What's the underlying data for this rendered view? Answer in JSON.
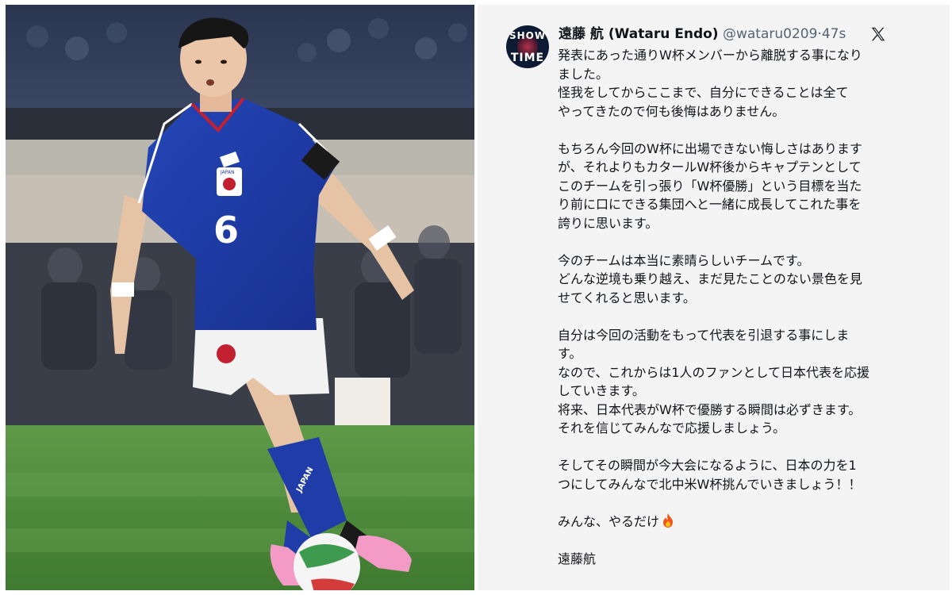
{
  "photo": {
    "description_label": "Japan national team player",
    "jersey_number": "6",
    "crest_text": "JAPAN",
    "sock_text": "JAPAN",
    "colors": {
      "jersey": "#1f3ca8",
      "shorts": "#f2f2f2",
      "pitch": "#4d8a3a",
      "boots": "#f39bc6"
    }
  },
  "post": {
    "avatar_line1": "SHOW",
    "avatar_line2": "TIME",
    "display_name": "遠藤 航 (Wataru Endo)",
    "handle": "@wataru0209",
    "separator": "·",
    "time": "47s",
    "platform_icon": "x-logo-icon",
    "lines": [
      "発表にあった通りW杯メンバーから離脱する事になり",
      "ました。",
      "怪我をしてからここまで、自分にできることは全て",
      "やってきたので何も後悔はありません。",
      "",
      "もちろん今回のW杯に出場できない悔しさはあります",
      "が、それよりもカタールW杯後からキャプテンとして",
      "このチームを引っ張り「W杯優勝」という目標を当た",
      "り前に口にできる集団へと一緒に成長してこれた事を",
      "誇りに思います。",
      "",
      "今のチームは本当に素晴らしいチームです。",
      "どんな逆境も乗り越え、まだ見たことのない景色を見",
      "せてくれると思います。",
      "",
      "自分は今回の活動をもって代表を引退する事にしま",
      "す。",
      "なので、これからは1人のファンとして日本代表を応援",
      "していきます。",
      "将来、日本代表がW杯で優勝する瞬間は必ずきます。",
      "それを信じてみんなで応援しましょう。",
      "",
      "そしてその瞬間が今大会になるように、日本の力を1",
      "つにしてみんなで北中米W杯挑んでいきましょう！！",
      "",
      "みんな、やるだけ",
      "",
      "遠藤航"
    ],
    "emoji_icon": "fire-icon"
  }
}
